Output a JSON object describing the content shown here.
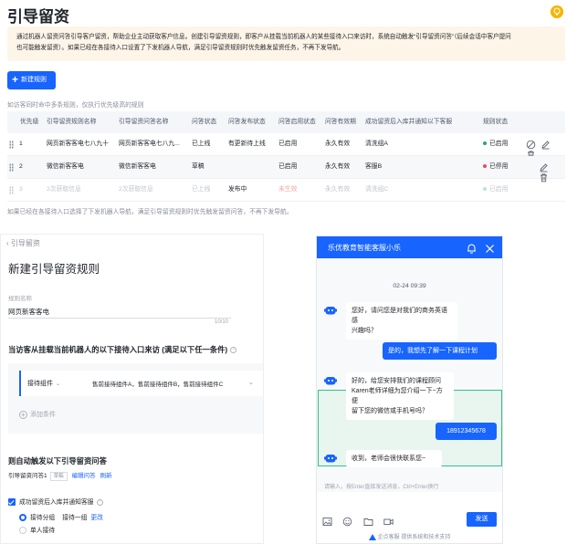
{
  "page": {
    "title": "引导留资",
    "notice_line1": "通过机器人留资问答引导客户留资，帮助企业主动获取客户信息。创建引导留资规则，即客户从挂载当前机器人的某些接待入口来访时，系统自动触发“引导留资问答”（后续会话中客户提问",
    "notice_line2": "也可能触发留资）。如果已经在各接待入口设置了下发机器人导航，满足引导留资规则时优先触发留资任务，不再下发导航。",
    "new_rule_label": "新建规则",
    "hint_top": "如访客同时命中多条规则，仅执行优先级高的规则",
    "hint_bottom": "如果已经在各接待入口选择了下发机器人导航，满足引导留资规则时优先触发留资问答，不再下发导航。"
  },
  "table": {
    "headers": [
      "优先级",
      "引导留资规则名称",
      "引导留资问答名称",
      "问答状态",
      "问答发布状态",
      "问答启用状态",
      "问答有效期",
      "成功留资后入库并通知以下客服",
      "规则状态"
    ],
    "rows": [
      [
        "1",
        "网页新客客电七八九十",
        "网页新客客电七八九...",
        "已上线",
        "有更新待上线",
        "已启用",
        "永久有效",
        "清洗组A",
        "已启用"
      ],
      [
        "2",
        "微信新客客电",
        "微信新客客电",
        "草稿",
        "",
        "已启用",
        "永久有效",
        "客服B",
        "已停用"
      ],
      [
        "3",
        "2次获取信息",
        "2次获取信息",
        "已上线",
        "发布中",
        "未生效",
        "永久有效",
        "清洗组C",
        "已启用"
      ]
    ],
    "status_colors": [
      "#2ba471",
      "#e34d59",
      "#c0c4cc"
    ]
  },
  "editor": {
    "back_label": "引导留资",
    "title": "新建引导留资规则",
    "name_label": "规则名称",
    "name_value": "网页新客客电",
    "name_count": "10/10",
    "condition_title": "当访客从挂载当前机器人的以下接待入口来访 (满足以下任一条件)",
    "condition_select": "接待组件",
    "condition_value": "售前接待组件A，售前接待组件B，售前接待组件C",
    "add_condition": "添加条件",
    "trigger_title": "则自动触发以下引导留资问答",
    "trigger_name": "引导留资问答1",
    "trigger_tag": "草稿",
    "edit_qa": "编辑问答",
    "refresh": "刷新",
    "notify_label": "成功留资后入库并通知客服",
    "radio1_label": "接待分组",
    "radio1_value": "接待一组",
    "radio1_change": "更改",
    "radio2_label": "单人接待"
  },
  "chat": {
    "title": "乐优教育智能客服小乐",
    "date": "02-24 09:39",
    "msg1": [
      "您好，请问您是对我们的商务英语感",
      "兴趣吗？"
    ],
    "msg2": "是的，我想先了解一下课程计划",
    "msg3": [
      "好的，给您安排我们的课程顾问",
      "Karen老师详细为您介绍一下~方便",
      "留下您的微信或手机号吗？"
    ],
    "msg4": "18912345678",
    "msg5": "收到，老师会很快联系您~",
    "placeholder": "请输入，按Enter直接发送消息，Ctrl+Enter换行",
    "send_label": "发送",
    "powered": "企点客服 提供系统和技术支持"
  }
}
